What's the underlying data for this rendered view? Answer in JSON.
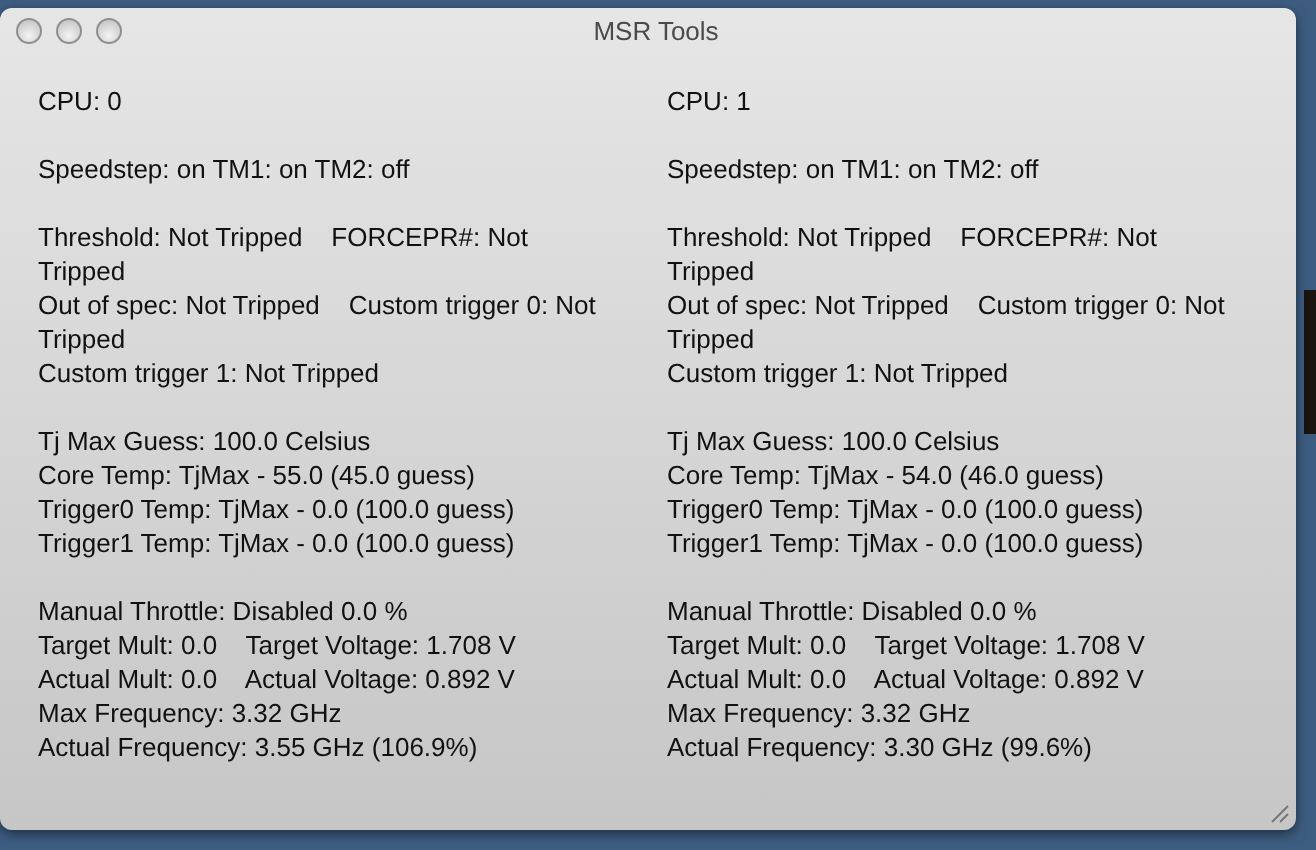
{
  "window": {
    "title": "MSR Tools"
  },
  "columns": [
    {
      "groups": [
        [
          "CPU: 0"
        ],
        [
          "Speedstep: on TM1: on TM2: off"
        ],
        [
          "Threshold: Not Tripped    FORCEPR#: Not Tripped",
          "Out of spec: Not Tripped    Custom trigger 0: Not Tripped",
          "Custom trigger 1: Not Tripped"
        ],
        [
          "Tj Max Guess: 100.0 Celsius",
          "Core Temp: TjMax - 55.0 (45.0 guess)",
          "Trigger0 Temp: TjMax - 0.0 (100.0 guess)",
          "Trigger1 Temp: TjMax - 0.0 (100.0 guess)"
        ],
        [
          "Manual Throttle: Disabled 0.0 %",
          "Target Mult: 0.0    Target Voltage: 1.708 V",
          "Actual Mult: 0.0    Actual Voltage: 0.892 V",
          "Max Frequency: 3.32 GHz",
          "Actual Frequency: 3.55 GHz (106.9%)"
        ]
      ]
    },
    {
      "groups": [
        [
          "CPU: 1"
        ],
        [
          "Speedstep: on TM1: on TM2: off"
        ],
        [
          "Threshold: Not Tripped    FORCEPR#: Not Tripped",
          "Out of spec: Not Tripped    Custom trigger 0: Not Tripped",
          "Custom trigger 1: Not Tripped"
        ],
        [
          "Tj Max Guess: 100.0 Celsius",
          "Core Temp: TjMax - 54.0 (46.0 guess)",
          "Trigger0 Temp: TjMax - 0.0 (100.0 guess)",
          "Trigger1 Temp: TjMax - 0.0 (100.0 guess)"
        ],
        [
          "Manual Throttle: Disabled 0.0 %",
          "Target Mult: 0.0    Target Voltage: 1.708 V",
          "Actual Mult: 0.0    Actual Voltage: 0.892 V",
          "Max Frequency: 3.32 GHz",
          "Actual Frequency: 3.30 GHz (99.6%)"
        ]
      ]
    }
  ]
}
